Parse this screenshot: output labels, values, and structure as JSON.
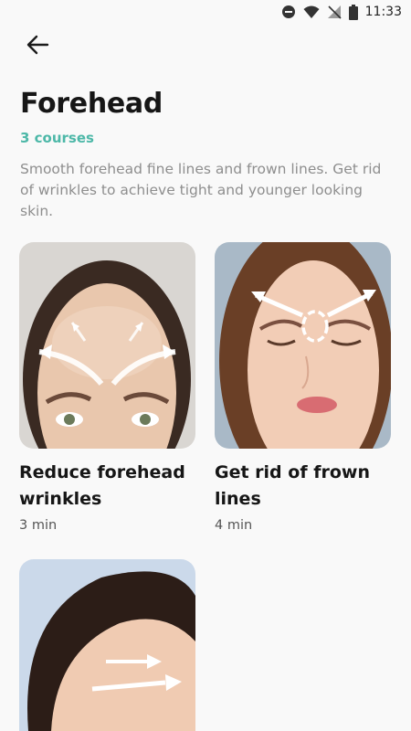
{
  "status_bar": {
    "time": "11:33",
    "icons": [
      "dnd-icon",
      "wifi-icon",
      "no-signal-icon",
      "battery-icon"
    ]
  },
  "header": {
    "back_icon": "arrow-left-icon"
  },
  "page": {
    "title": "Forehead",
    "courses_count": "3 courses",
    "description": "Smooth forehead fine lines and frown lines. Get rid of wrinkles to achieve tight and younger looking skin."
  },
  "colors": {
    "accent": "#4db8a8",
    "background": "#f9f9f9",
    "description_text": "#8e8e8e"
  },
  "courses": [
    {
      "title": "Reduce forehead wrinkles",
      "duration": "3 min",
      "image": "forehead-massage-photo"
    },
    {
      "title": "Get rid of frown lines",
      "duration": "4 min",
      "image": "frown-lines-massage-photo"
    },
    {
      "title": "",
      "duration": "",
      "image": "hairline-forehead-massage-photo"
    }
  ]
}
